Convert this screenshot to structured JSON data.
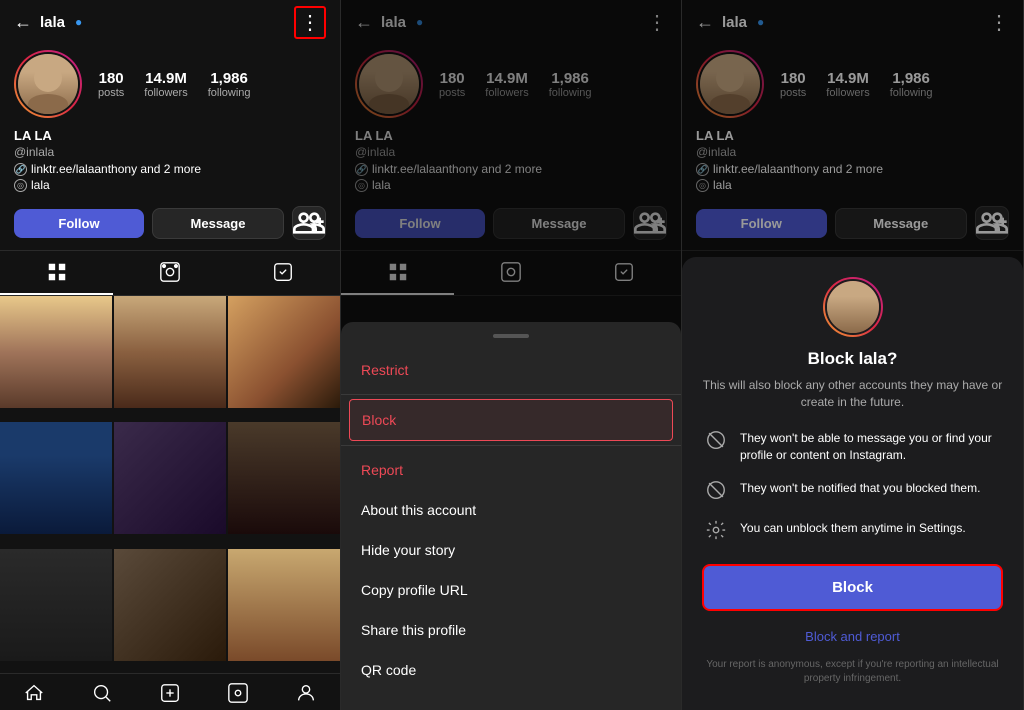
{
  "panels": [
    {
      "id": "panel1",
      "nav": {
        "back_label": "←",
        "username": "lala",
        "more_label": "⋮",
        "more_highlighted": true
      },
      "profile": {
        "display_name": "LA LA",
        "handle": "@inlala",
        "link": "linktr.ee/lalaanthony and 2 more",
        "tag": "lala",
        "stats": [
          {
            "num": "180",
            "label": "posts"
          },
          {
            "num": "14.9M",
            "label": "followers"
          },
          {
            "num": "1,986",
            "label": "following"
          }
        ]
      },
      "actions": {
        "follow_label": "Follow",
        "message_label": "Message",
        "person_add_icon": "person+"
      },
      "tabs": [
        "grid",
        "reels",
        "tagged"
      ],
      "active_tab": 0
    },
    {
      "id": "panel2",
      "nav": {
        "back_label": "←",
        "username": "lala",
        "more_label": "⋮"
      },
      "profile": {
        "display_name": "LA LA",
        "handle": "@inlala",
        "link": "linktr.ee/lalaanthony and 2 more",
        "tag": "lala",
        "stats": [
          {
            "num": "180",
            "label": "posts"
          },
          {
            "num": "14.9M",
            "label": "followers"
          },
          {
            "num": "1,986",
            "label": "following"
          }
        ]
      },
      "actions": {
        "follow_label": "Follow",
        "message_label": "Message"
      },
      "menu": {
        "items": [
          {
            "label": "Restrict",
            "type": "red"
          },
          {
            "label": "Block",
            "type": "block-highlighted"
          },
          {
            "label": "Report",
            "type": "red"
          },
          {
            "label": "About this account",
            "type": "normal"
          },
          {
            "label": "Hide your story",
            "type": "normal"
          },
          {
            "label": "Copy profile URL",
            "type": "normal"
          },
          {
            "label": "Share this profile",
            "type": "normal"
          },
          {
            "label": "QR code",
            "type": "normal"
          }
        ]
      }
    },
    {
      "id": "panel3",
      "nav": {
        "back_label": "←",
        "username": "lala",
        "more_label": "⋮"
      },
      "profile": {
        "display_name": "LA LA",
        "handle": "@inlala",
        "link": "linktr.ee/lalaanthony and 2 more",
        "tag": "lala",
        "stats": [
          {
            "num": "180",
            "label": "posts"
          },
          {
            "num": "14.9M",
            "label": "followers"
          },
          {
            "num": "1,986",
            "label": "following"
          }
        ]
      },
      "actions": {
        "follow_label": "Follow",
        "message_label": "Message"
      },
      "block_dialog": {
        "title": "Block lala?",
        "description": "This will also block any other accounts they may have or create in the future.",
        "reasons": [
          "They won't be able to message you or find your profile or content on Instagram.",
          "They won't be notified that you blocked them.",
          "You can unblock them anytime in Settings."
        ],
        "block_button": "Block",
        "block_report_button": "Block and report",
        "footer_note": "Your report is anonymous, except if you're reporting an intellectual property infringement."
      }
    }
  ]
}
